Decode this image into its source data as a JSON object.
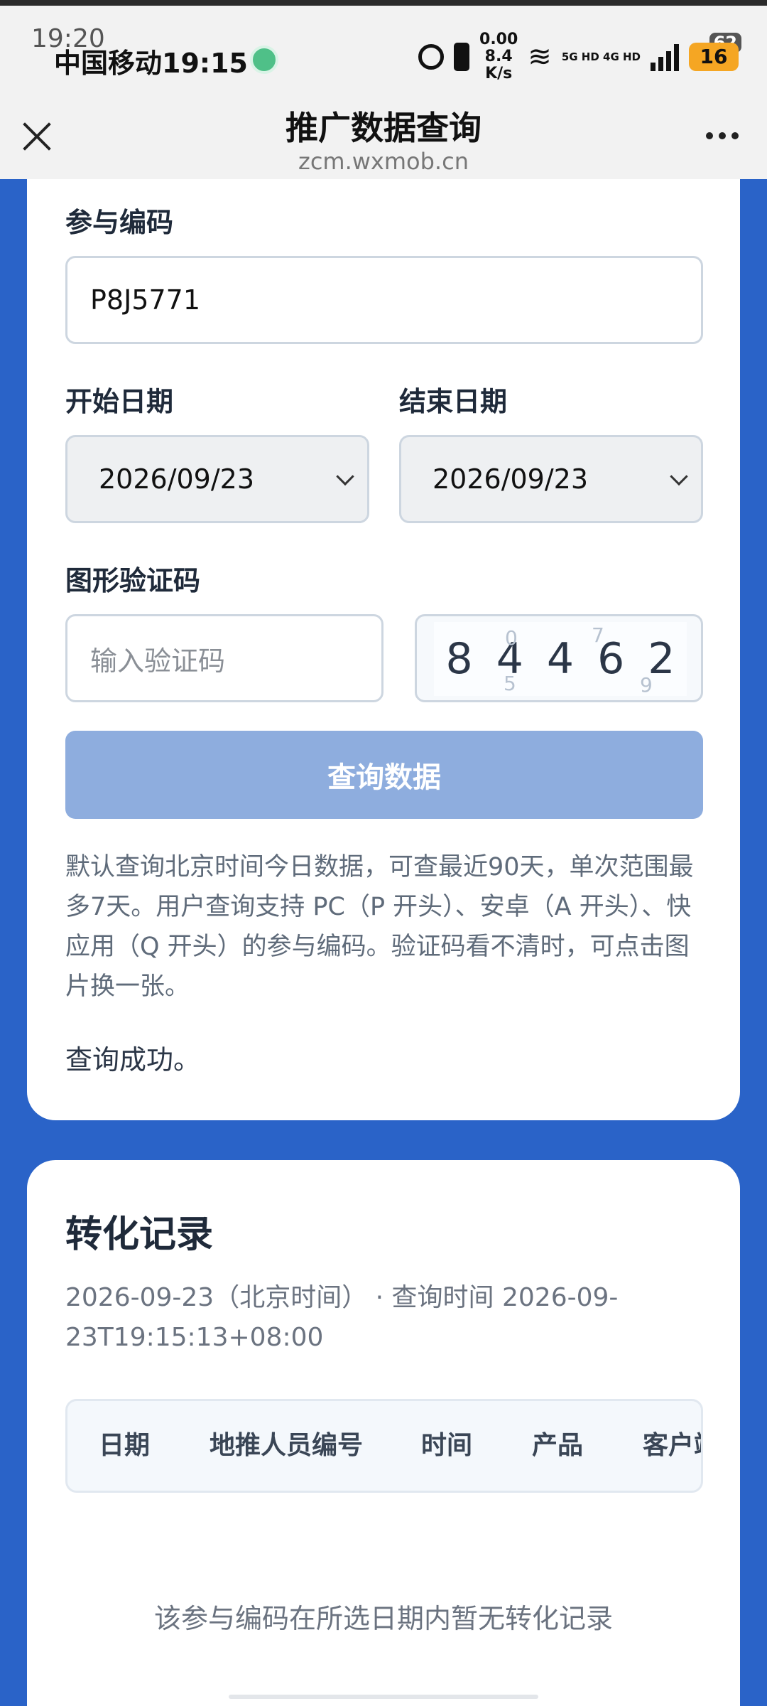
{
  "status_bar": {
    "ghost_time": "19:20",
    "carrier_time": "中国移动19:15",
    "net_speed_value": "8.4",
    "net_speed_unit": "K/s",
    "net_small": "0.00",
    "net_badges": "5G HD 4G HD",
    "battery": "16",
    "battery_ghost": "62"
  },
  "nav": {
    "title": "推广数据查询",
    "url": "zcm.wxmob.cn"
  },
  "form": {
    "code_label": "参与编码",
    "code_value": "P8J5771",
    "start_label": "开始日期",
    "start_value": "2026/09/23",
    "end_label": "结束日期",
    "end_value": "2026/09/23",
    "captcha_label": "图形验证码",
    "captcha_placeholder": "输入验证码",
    "captcha_digits": [
      "8",
      "4",
      "4",
      "6",
      "2"
    ],
    "query_button": "查询数据",
    "hint": "默认查询北京时间今日数据，可查最近90天，单次范围最多7天。用户查询支持 PC（P 开头）、安卓（A 开头）、快应用（Q 开头）的参与编码。验证码看不清时，可点击图片换一张。",
    "status": "查询成功。"
  },
  "records": {
    "title": "转化记录",
    "meta": "2026-09-23（北京时间） · 查询时间 2026-09-23T19:15:13+08:00",
    "columns": [
      "日期",
      "地推人员编号",
      "时间",
      "产品",
      "客户端"
    ],
    "empty_text": "该参与编码在所选日期内暂无转化记录"
  }
}
